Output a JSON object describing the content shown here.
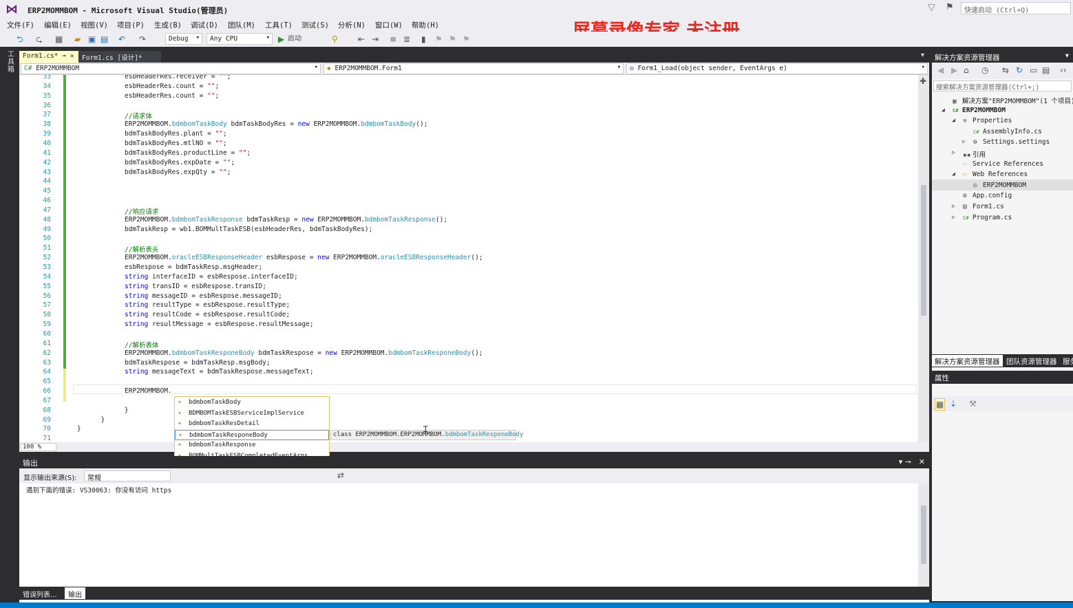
{
  "window": {
    "title": "ERP2MOMMBOM - Microsoft Visual Studio(管理员)",
    "quick_launch_placeholder": "快速启动 (Ctrl+Q)"
  },
  "watermark": "屏幕录像专家  未注册",
  "menu": [
    "文件(F)",
    "编辑(E)",
    "视图(V)",
    "项目(P)",
    "生成(B)",
    "调试(D)",
    "团队(M)",
    "工具(T)",
    "测试(S)",
    "分析(N)",
    "窗口(W)",
    "帮助(H)"
  ],
  "toolbar": {
    "config": "Debug",
    "platform": "Any CPU",
    "start_label": "启动"
  },
  "toolbox_tab": "工具箱",
  "tabs": [
    {
      "label": "Form1.cs*"
    },
    {
      "label": "Form1.cs [设计]*"
    }
  ],
  "nav": {
    "project": "ERP2MOMMBOM",
    "class": "ERP2MOMMBOM.Form1",
    "member": "Form1_Load(object sender, EventArgs e)"
  },
  "code_lines": [
    {
      "n": "33",
      "tokens": [
        [
          "",
          "esbHeaderRes.receiver = "
        ],
        [
          "st",
          "\"\""
        ],
        [
          "",
          ";"
        ]
      ]
    },
    {
      "n": "34",
      "tokens": [
        [
          "",
          "esbHeaderRes.count = "
        ],
        [
          "st",
          "\"\""
        ],
        [
          "",
          ";"
        ]
      ]
    },
    {
      "n": "35",
      "tokens": [
        [
          "",
          "esbHeaderRes.count = "
        ],
        [
          "st",
          "\"\""
        ],
        [
          "",
          ";"
        ]
      ]
    },
    {
      "n": "36",
      "tokens": []
    },
    {
      "n": "37",
      "tokens": [
        [
          "cm",
          "//请求体"
        ]
      ]
    },
    {
      "n": "38",
      "tokens": [
        [
          "",
          "ERP2MOMMBOM."
        ],
        [
          "ty",
          "bdmbomTaskBody"
        ],
        [
          "",
          " bdmTaskBodyRes = "
        ],
        [
          "kw",
          "new"
        ],
        [
          "",
          " ERP2MOMMBOM."
        ],
        [
          "ty",
          "bdmbomTaskBody"
        ],
        [
          "",
          "();"
        ]
      ]
    },
    {
      "n": "39",
      "tokens": [
        [
          "",
          "bdmTaskBodyRes.plant = "
        ],
        [
          "st",
          "\"\""
        ],
        [
          "",
          ";"
        ]
      ]
    },
    {
      "n": "40",
      "tokens": [
        [
          "",
          "bdmTaskBodyRes.mtlNO = "
        ],
        [
          "st",
          "\"\""
        ],
        [
          "",
          ";"
        ]
      ]
    },
    {
      "n": "41",
      "tokens": [
        [
          "",
          "bdmTaskBodyRes.productLine = "
        ],
        [
          "st",
          "\"\""
        ],
        [
          "",
          ";"
        ]
      ]
    },
    {
      "n": "42",
      "tokens": [
        [
          "",
          "bdmTaskBodyRes.expDate = "
        ],
        [
          "st",
          "\"\""
        ],
        [
          "",
          ";"
        ]
      ]
    },
    {
      "n": "43",
      "tokens": [
        [
          "",
          "bdmTaskBodyRes.expQty = "
        ],
        [
          "st",
          "\"\""
        ],
        [
          "",
          ";"
        ]
      ]
    },
    {
      "n": "44",
      "tokens": []
    },
    {
      "n": "45",
      "tokens": []
    },
    {
      "n": "46",
      "tokens": []
    },
    {
      "n": "47",
      "tokens": [
        [
          "cm",
          "//响应请求"
        ]
      ]
    },
    {
      "n": "48",
      "tokens": [
        [
          "",
          "ERP2MOMMBOM."
        ],
        [
          "ty",
          "bdmbomTaskResponse"
        ],
        [
          "",
          " bdmTaskResp = "
        ],
        [
          "kw",
          "new"
        ],
        [
          "",
          " ERP2MOMMBOM."
        ],
        [
          "ty",
          "bdmbomTaskResponse"
        ],
        [
          "",
          "();"
        ]
      ]
    },
    {
      "n": "49",
      "tokens": [
        [
          "",
          "bdmTaskResp = wb1.BOMMultTaskESB(esbHeaderRes, bdmTaskBodyRes);"
        ]
      ]
    },
    {
      "n": "50",
      "tokens": []
    },
    {
      "n": "51",
      "tokens": [
        [
          "cm",
          "//解析表头"
        ]
      ]
    },
    {
      "n": "52",
      "tokens": [
        [
          "",
          "ERP2MOMMBOM."
        ],
        [
          "ty",
          "oracleESBResponseHeader"
        ],
        [
          "",
          " esbRespose = "
        ],
        [
          "kw",
          "new"
        ],
        [
          "",
          " ERP2MOMMBOM."
        ],
        [
          "ty",
          "oracleESBResponseHeader"
        ],
        [
          "",
          "();"
        ]
      ]
    },
    {
      "n": "53",
      "tokens": [
        [
          "",
          "esbRespose = bdmTaskResp.msgHeader;"
        ]
      ]
    },
    {
      "n": "54",
      "tokens": [
        [
          "kw",
          "string"
        ],
        [
          "",
          " interfaceID = esbRespose.interfaceID;"
        ]
      ]
    },
    {
      "n": "55",
      "tokens": [
        [
          "kw",
          "string"
        ],
        [
          "",
          " transID = esbRespose.transID;"
        ]
      ]
    },
    {
      "n": "56",
      "tokens": [
        [
          "kw",
          "string"
        ],
        [
          "",
          " messageID = esbRespose.messageID;"
        ]
      ]
    },
    {
      "n": "57",
      "tokens": [
        [
          "kw",
          "string"
        ],
        [
          "",
          " resultType = esbRespose.resultType;"
        ]
      ]
    },
    {
      "n": "58",
      "tokens": [
        [
          "kw",
          "string"
        ],
        [
          "",
          " resultCode = esbRespose.resultCode;"
        ]
      ]
    },
    {
      "n": "59",
      "tokens": [
        [
          "kw",
          "string"
        ],
        [
          "",
          " resultMessage = esbRespose.resultMessage;"
        ]
      ]
    },
    {
      "n": "60",
      "tokens": []
    },
    {
      "n": "61",
      "tokens": [
        [
          "cm",
          "//解析表体"
        ]
      ]
    },
    {
      "n": "62",
      "tokens": [
        [
          "",
          "ERP2MOMMBOM."
        ],
        [
          "ty",
          "bdmbomTaskResponeBody"
        ],
        [
          "",
          " bdmTaskRespose = "
        ],
        [
          "kw",
          "new"
        ],
        [
          "",
          " ERP2MOMMBOM."
        ],
        [
          "ty",
          "bdmbomTaskResponeBody"
        ],
        [
          "",
          "();"
        ]
      ]
    },
    {
      "n": "63",
      "tokens": [
        [
          "",
          "bdmTaskRespose = bdmTaskResp.msgBody;"
        ]
      ]
    },
    {
      "n": "64",
      "tokens": [
        [
          "kw",
          "string"
        ],
        [
          "",
          " messageText = bdmTaskRespose.messageText;"
        ]
      ]
    },
    {
      "n": "65",
      "tokens": []
    },
    {
      "n": "66",
      "tokens": [
        [
          "",
          "ERP2MOMMBOM."
        ]
      ]
    },
    {
      "n": "67",
      "tokens": []
    },
    {
      "n": "68",
      "tokens": [
        [
          "",
          "    }"
        ]
      ],
      "indent": -2
    },
    {
      "n": "69",
      "tokens": [
        [
          "",
          "  }"
        ]
      ],
      "indent": -4
    },
    {
      "n": "70",
      "tokens": [
        [
          "",
          "}"
        ]
      ],
      "indent": -6
    },
    {
      "n": "71",
      "tokens": []
    }
  ],
  "intellisense": {
    "items": [
      {
        "label": "bdmbomTaskBody",
        "icon": "class-icon"
      },
      {
        "label": "BDMBOMTaskESBServiceImplService",
        "icon": "class-icon"
      },
      {
        "label": "bdmbomTaskResDetail",
        "icon": "class-icon"
      },
      {
        "label": "bdmbomTaskResponeBody",
        "icon": "class-icon",
        "selected": true
      },
      {
        "label": "bdmbomTaskResponse",
        "icon": "class-icon"
      },
      {
        "label": "BOMMultTaskESBCompletedEventArgs",
        "icon": "class-icon"
      },
      {
        "label": "BOMMultTaskESBCompletedEventHandler",
        "icon": "delegate-icon"
      },
      {
        "label": "oracleESBMesHeader",
        "icon": "class-icon"
      },
      {
        "label": "oracleESBResponseHeader",
        "icon": "class-icon"
      }
    ],
    "tooltip_prefix": "class ERP2MOMMBOM.ERP2MOMMBOM.",
    "tooltip_type": "bdmbomTaskResponeBody"
  },
  "zoom": "100 %",
  "output": {
    "title": "输出",
    "source_label": "显示输出来源(S):",
    "source_value": "常规",
    "message": "遇到下面的错误: VS30063: 你没有访问 https",
    "tabs": [
      "错误列表...",
      "输出"
    ]
  },
  "solution_explorer": {
    "title": "解决方案资源管理器",
    "search_placeholder": "搜索解决方案资源管理器(Ctrl+;)",
    "tree": [
      {
        "label": "解决方案\"ERP2MOMMBOM\"(1 个项目)",
        "icon": "solution-icon",
        "level": 0
      },
      {
        "label": "ERP2MOMMBOM",
        "icon": "csproj-icon",
        "level": 0,
        "expander": "◢",
        "bold": true
      },
      {
        "label": "Properties",
        "icon": "wrench-icon",
        "level": 1,
        "expander": "◢"
      },
      {
        "label": "AssemblyInfo.cs",
        "icon": "cs-file-icon",
        "level": 2
      },
      {
        "label": "Settings.settings",
        "icon": "settings-icon",
        "level": 2,
        "expander": "▷"
      },
      {
        "label": "引用",
        "icon": "references-icon",
        "level": 1,
        "expander": "▷"
      },
      {
        "label": "Service References",
        "icon": "folder-icon",
        "level": 1
      },
      {
        "label": "Web References",
        "icon": "folder-icon",
        "level": 1,
        "expander": "◢"
      },
      {
        "label": "ERP2MOMMBOM",
        "icon": "web-reference-icon",
        "level": 2,
        "selected": true
      },
      {
        "label": "App.config",
        "icon": "config-icon",
        "level": 1
      },
      {
        "label": "Form1.cs",
        "icon": "form-icon",
        "level": 1,
        "expander": "▷"
      },
      {
        "label": "Program.cs",
        "icon": "cs-file-icon",
        "level": 1,
        "expander": "▷"
      }
    ],
    "bottom_tabs": [
      "解决方案资源管理器",
      "团队资源管理器",
      "服务"
    ]
  },
  "properties": {
    "title": "属性"
  }
}
